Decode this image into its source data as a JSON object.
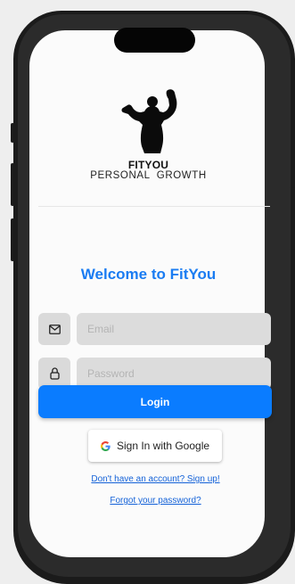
{
  "brand": {
    "name": "FITYOU",
    "tagline": "PERSONAL  GROWTH"
  },
  "welcome": "Welcome to FitYou",
  "email": {
    "icon": "envelope-icon",
    "placeholder": "Email"
  },
  "password": {
    "icon": "lock-icon",
    "placeholder": "Password"
  },
  "login_label": "Login",
  "google": {
    "icon": "google-g-icon",
    "label": "Sign In with Google"
  },
  "links": {
    "signup": "Don't have an account? Sign up!",
    "forgot": "Forgot your password?"
  },
  "colors": {
    "accent": "#0A7CFF",
    "title": "#1A7CF2",
    "link": "#1462D8"
  }
}
